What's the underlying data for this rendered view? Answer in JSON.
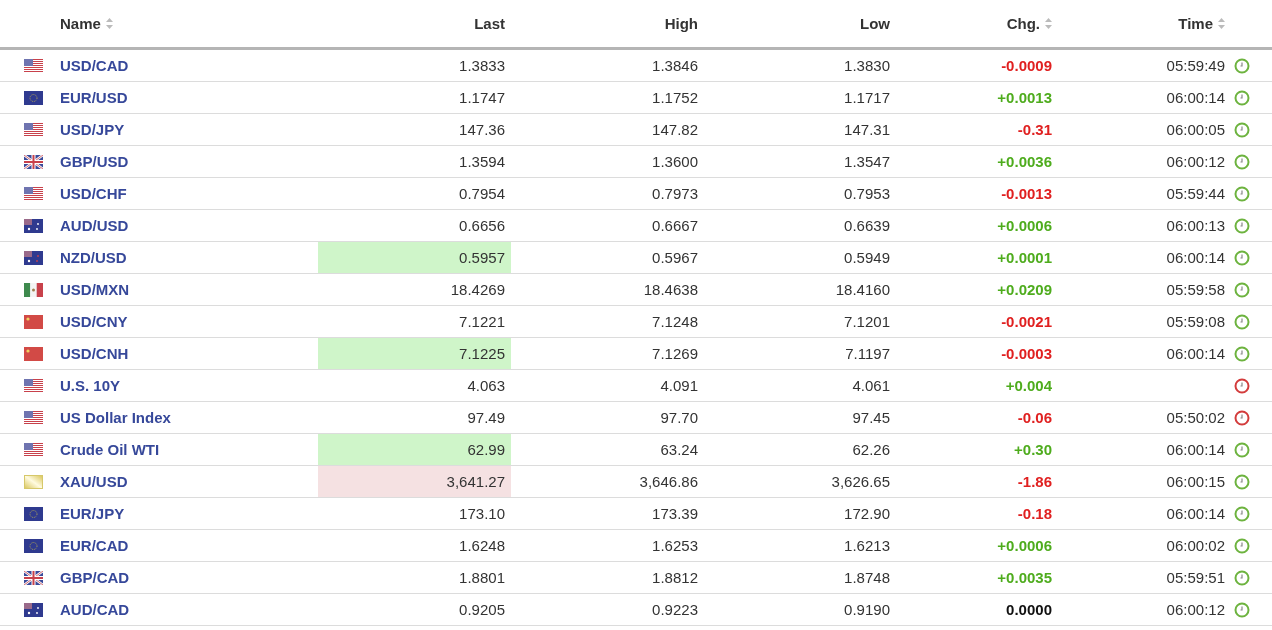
{
  "table": {
    "columns": [
      {
        "label": "Name",
        "sortable": true
      },
      {
        "label": "Last",
        "sortable": false
      },
      {
        "label": "High",
        "sortable": false
      },
      {
        "label": "Low",
        "sortable": false
      },
      {
        "label": "Chg.",
        "sortable": true
      },
      {
        "label": "Time",
        "sortable": true
      }
    ],
    "rows": [
      {
        "kind": "us",
        "name": "USD/CAD",
        "last": "1.3833",
        "flash_up": false,
        "flash_down": false,
        "high": "1.3846",
        "low": "1.3830",
        "chg": "-0.0009",
        "rising": false,
        "unchanged": false,
        "time": "05:59:49",
        "market_open": true
      },
      {
        "kind": "eu",
        "name": "EUR/USD",
        "last": "1.1747",
        "flash_up": false,
        "flash_down": false,
        "high": "1.1752",
        "low": "1.1717",
        "chg": "+0.0013",
        "rising": true,
        "unchanged": false,
        "time": "06:00:14",
        "market_open": true
      },
      {
        "kind": "us",
        "name": "USD/JPY",
        "last": "147.36",
        "flash_up": false,
        "flash_down": false,
        "high": "147.82",
        "low": "147.31",
        "chg": "-0.31",
        "rising": false,
        "unchanged": false,
        "time": "06:00:05",
        "market_open": true
      },
      {
        "kind": "gb",
        "name": "GBP/USD",
        "last": "1.3594",
        "flash_up": false,
        "flash_down": false,
        "high": "1.3600",
        "low": "1.3547",
        "chg": "+0.0036",
        "rising": true,
        "unchanged": false,
        "time": "06:00:12",
        "market_open": true
      },
      {
        "kind": "us",
        "name": "USD/CHF",
        "last": "0.7954",
        "flash_up": false,
        "flash_down": false,
        "high": "0.7973",
        "low": "0.7953",
        "chg": "-0.0013",
        "rising": false,
        "unchanged": false,
        "time": "05:59:44",
        "market_open": true
      },
      {
        "kind": "au",
        "name": "AUD/USD",
        "last": "0.6656",
        "flash_up": false,
        "flash_down": false,
        "high": "0.6667",
        "low": "0.6639",
        "chg": "+0.0006",
        "rising": true,
        "unchanged": false,
        "time": "06:00:13",
        "market_open": true
      },
      {
        "kind": "nz",
        "name": "NZD/USD",
        "last": "0.5957",
        "flash_up": true,
        "flash_down": false,
        "high": "0.5967",
        "low": "0.5949",
        "chg": "+0.0001",
        "rising": true,
        "unchanged": false,
        "time": "06:00:14",
        "market_open": true
      },
      {
        "kind": "mx",
        "name": "USD/MXN",
        "last": "18.4269",
        "flash_up": false,
        "flash_down": false,
        "high": "18.4638",
        "low": "18.4160",
        "chg": "+0.0209",
        "rising": true,
        "unchanged": false,
        "time": "05:59:58",
        "market_open": true
      },
      {
        "kind": "cn",
        "name": "USD/CNY",
        "last": "7.1221",
        "flash_up": false,
        "flash_down": false,
        "high": "7.1248",
        "low": "7.1201",
        "chg": "-0.0021",
        "rising": false,
        "unchanged": false,
        "time": "05:59:08",
        "market_open": true
      },
      {
        "kind": "cn",
        "name": "USD/CNH",
        "last": "7.1225",
        "flash_up": true,
        "flash_down": false,
        "high": "7.1269",
        "low": "7.1197",
        "chg": "-0.0003",
        "rising": false,
        "unchanged": false,
        "time": "06:00:14",
        "market_open": true
      },
      {
        "kind": "us",
        "name": "U.S. 10Y",
        "last": "4.063",
        "flash_up": false,
        "flash_down": false,
        "high": "4.091",
        "low": "4.061",
        "chg": "+0.004",
        "rising": true,
        "unchanged": false,
        "market_open": false
      },
      {
        "kind": "us",
        "name": "US Dollar Index",
        "last": "97.49",
        "flash_up": false,
        "flash_down": false,
        "high": "97.70",
        "low": "97.45",
        "chg": "-0.06",
        "rising": false,
        "unchanged": false,
        "time": "05:50:02",
        "market_open": false
      },
      {
        "kind": "us",
        "name": "Crude Oil WTI",
        "last": "62.99",
        "flash_up": true,
        "flash_down": false,
        "high": "63.24",
        "low": "62.26",
        "chg": "+0.30",
        "rising": true,
        "unchanged": false,
        "time": "06:00:14",
        "market_open": true
      },
      {
        "kind": "gold",
        "name": "XAU/USD",
        "last": "3,641.27",
        "flash_up": false,
        "flash_down": true,
        "high": "3,646.86",
        "low": "3,626.65",
        "chg": "-1.86",
        "rising": false,
        "unchanged": false,
        "time": "06:00:15",
        "market_open": true
      },
      {
        "kind": "eu",
        "name": "EUR/JPY",
        "last": "173.10",
        "flash_up": false,
        "flash_down": false,
        "high": "173.39",
        "low": "172.90",
        "chg": "-0.18",
        "rising": false,
        "unchanged": false,
        "time": "06:00:14",
        "market_open": true
      },
      {
        "kind": "eu",
        "name": "EUR/CAD",
        "last": "1.6248",
        "flash_up": false,
        "flash_down": false,
        "high": "1.6253",
        "low": "1.6213",
        "chg": "+0.0006",
        "rising": true,
        "unchanged": false,
        "time": "06:00:02",
        "market_open": true
      },
      {
        "kind": "gb",
        "name": "GBP/CAD",
        "last": "1.8801",
        "flash_up": false,
        "flash_down": false,
        "high": "1.8812",
        "low": "1.8748",
        "chg": "+0.0035",
        "rising": true,
        "unchanged": false,
        "time": "05:59:51",
        "market_open": true
      },
      {
        "kind": "au",
        "name": "AUD/CAD",
        "last": "0.9205",
        "flash_up": false,
        "flash_down": false,
        "high": "0.9223",
        "low": "0.9190",
        "chg": "0.0000",
        "rising": false,
        "unchanged": true,
        "time": "06:00:12",
        "market_open": true
      }
    ]
  }
}
